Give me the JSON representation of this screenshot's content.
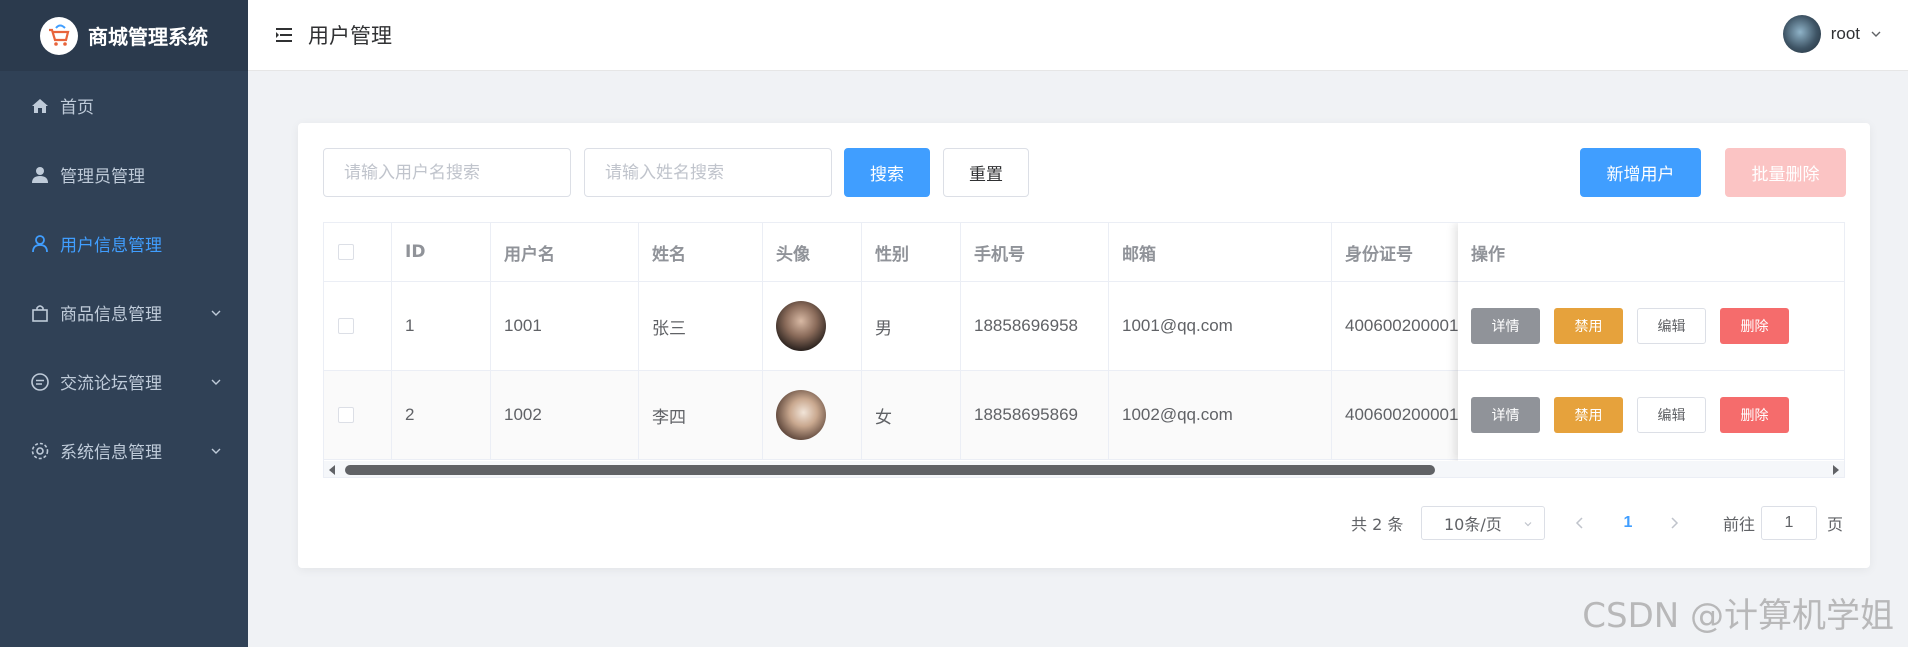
{
  "app": {
    "title": "商城管理系统"
  },
  "sidebar": {
    "items": [
      {
        "label": "首页",
        "icon": "home-icon",
        "active": false,
        "expandable": false
      },
      {
        "label": "管理员管理",
        "icon": "user-solid-icon",
        "active": false,
        "expandable": false
      },
      {
        "label": "用户信息管理",
        "icon": "user-outline-icon",
        "active": true,
        "expandable": false
      },
      {
        "label": "商品信息管理",
        "icon": "shopping-bag-icon",
        "active": false,
        "expandable": true
      },
      {
        "label": "交流论坛管理",
        "icon": "chat-icon",
        "active": false,
        "expandable": true
      },
      {
        "label": "系统信息管理",
        "icon": "gear-icon",
        "active": false,
        "expandable": true
      }
    ]
  },
  "header": {
    "title": "用户管理",
    "username": "root"
  },
  "toolbar": {
    "username_placeholder": "请输入用户名搜索",
    "name_placeholder": "请输入姓名搜索",
    "search_label": "搜索",
    "reset_label": "重置",
    "add_label": "新增用户",
    "batch_delete_label": "批量删除"
  },
  "table": {
    "columns": [
      "",
      "ID",
      "用户名",
      "姓名",
      "头像",
      "性别",
      "手机号",
      "邮箱",
      "身份证号",
      "操作"
    ],
    "rows": [
      {
        "id": "1",
        "username": "1001",
        "name": "张三",
        "gender": "男",
        "phone": "18858696958",
        "email": "1001@qq.com",
        "idcard": "400600200001"
      },
      {
        "id": "2",
        "username": "1002",
        "name": "李四",
        "gender": "女",
        "phone": "18858695869",
        "email": "1002@qq.com",
        "idcard": "400600200001"
      }
    ],
    "actions": {
      "detail": "详情",
      "disable": "禁用",
      "edit": "编辑",
      "delete": "删除"
    }
  },
  "pagination": {
    "total_text": "共 2 条",
    "page_size": "10条/页",
    "current_page": "1",
    "goto_label": "前往",
    "goto_value": "1",
    "page_suffix": "页"
  },
  "watermark": "CSDN @计算机学姐",
  "colors": {
    "sidebar_bg": "#304156",
    "accent": "#409eff",
    "warning": "#e6a23c",
    "danger": "#f56c6c",
    "info": "#909399"
  }
}
